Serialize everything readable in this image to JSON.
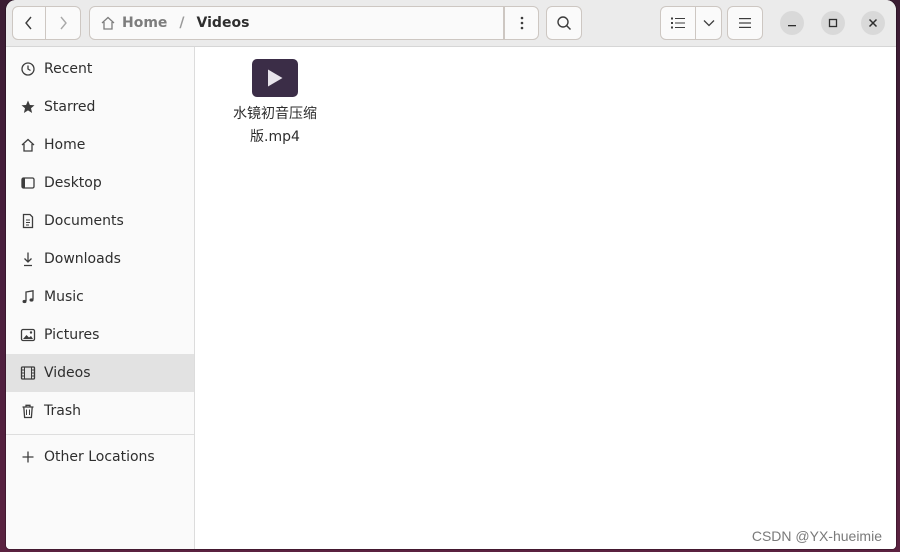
{
  "window": {
    "path": {
      "home": "Home",
      "separator": "/",
      "current": "Videos"
    }
  },
  "sidebar": {
    "items": [
      {
        "label": "Recent",
        "icon": "clock-icon"
      },
      {
        "label": "Starred",
        "icon": "star-icon"
      },
      {
        "label": "Home",
        "icon": "home-icon"
      },
      {
        "label": "Desktop",
        "icon": "desktop-icon"
      },
      {
        "label": "Documents",
        "icon": "document-icon"
      },
      {
        "label": "Downloads",
        "icon": "download-icon"
      },
      {
        "label": "Music",
        "icon": "music-icon"
      },
      {
        "label": "Pictures",
        "icon": "picture-icon"
      },
      {
        "label": "Videos",
        "icon": "film-icon",
        "selected": true
      },
      {
        "label": "Trash",
        "icon": "trash-icon"
      }
    ],
    "other_locations": "Other Locations"
  },
  "files": [
    {
      "name": "水镜初音压缩版.mp4",
      "type": "video"
    }
  ],
  "watermark": "CSDN @YX-hueimie",
  "colors": {
    "selected_bg": "#e2e2e2",
    "thumb_bg": "#3b2d47",
    "desktop_bg": "#4a1f3e"
  }
}
